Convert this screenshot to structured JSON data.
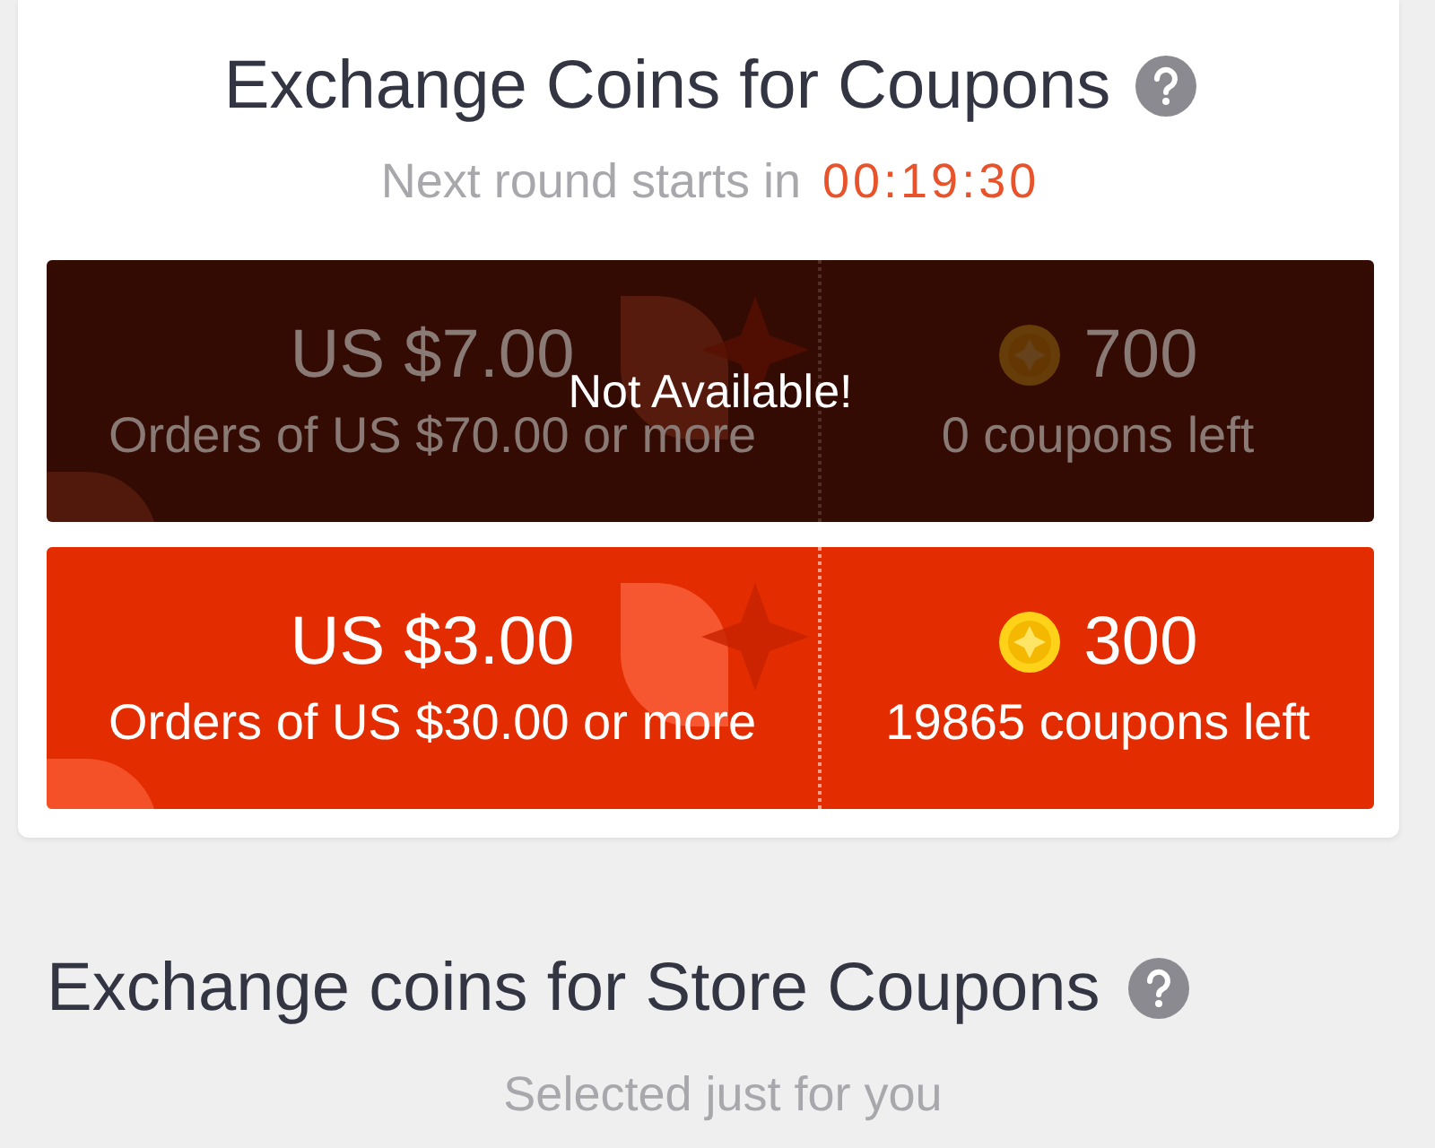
{
  "coin_exchange": {
    "title": "Exchange Coins for Coupons",
    "countdown_label": "Next round starts in",
    "countdown": "00:19:30",
    "coupons": [
      {
        "value": "US $7.00",
        "condition": "Orders of US $70.00 or more",
        "coins": "700",
        "remaining": "0 coupons left",
        "available": false,
        "overlay": "Not Available!"
      },
      {
        "value": "US $3.00",
        "condition": "Orders of US $30.00 or more",
        "coins": "300",
        "remaining": "19865 coupons left",
        "available": true
      }
    ]
  },
  "store_exchange": {
    "title": "Exchange coins for Store Coupons",
    "subtitle": "Selected just for you"
  }
}
